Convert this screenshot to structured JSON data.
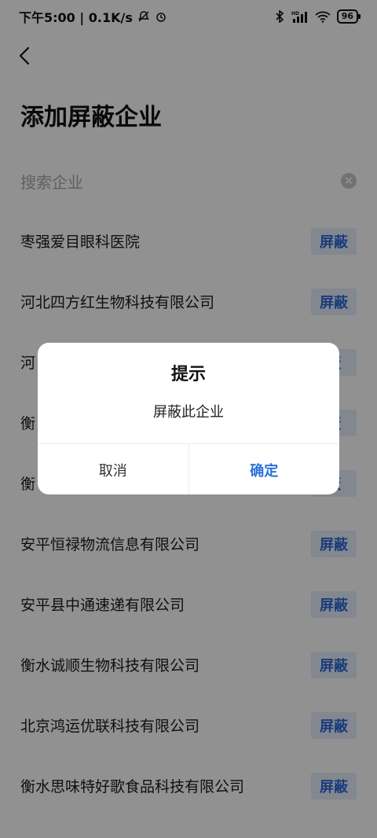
{
  "status_bar": {
    "time_speed": "下午5:00 | 0.1K/s",
    "battery": "96",
    "network": "HD"
  },
  "page": {
    "title": "添加屏蔽企业",
    "search_placeholder": "搜索企业"
  },
  "companies": [
    {
      "name": "枣强爱目眼科医院",
      "action": "屏蔽"
    },
    {
      "name": "河北四方红生物科技有限公司",
      "action": "屏蔽"
    },
    {
      "name": "河",
      "action": "蔽"
    },
    {
      "name": "衡",
      "action": "蔽"
    },
    {
      "name": "衡",
      "action": "蔽"
    },
    {
      "name": "安平恒禄物流信息有限公司",
      "action": "屏蔽"
    },
    {
      "name": "安平县中通速递有限公司",
      "action": "屏蔽"
    },
    {
      "name": "衡水诚顺生物科技有限公司",
      "action": "屏蔽"
    },
    {
      "name": "北京鸿运优联科技有限公司",
      "action": "屏蔽"
    },
    {
      "name": "衡水思味特好歌食品科技有限公司",
      "action": "屏蔽"
    }
  ],
  "dialog": {
    "title": "提示",
    "message": "屏蔽此企业",
    "cancel": "取消",
    "confirm": "确定"
  },
  "colors": {
    "accent": "#2a72d8",
    "block_btn_bg": "#e7eefb",
    "overlay": "rgba(0,0,0,0.43)"
  }
}
